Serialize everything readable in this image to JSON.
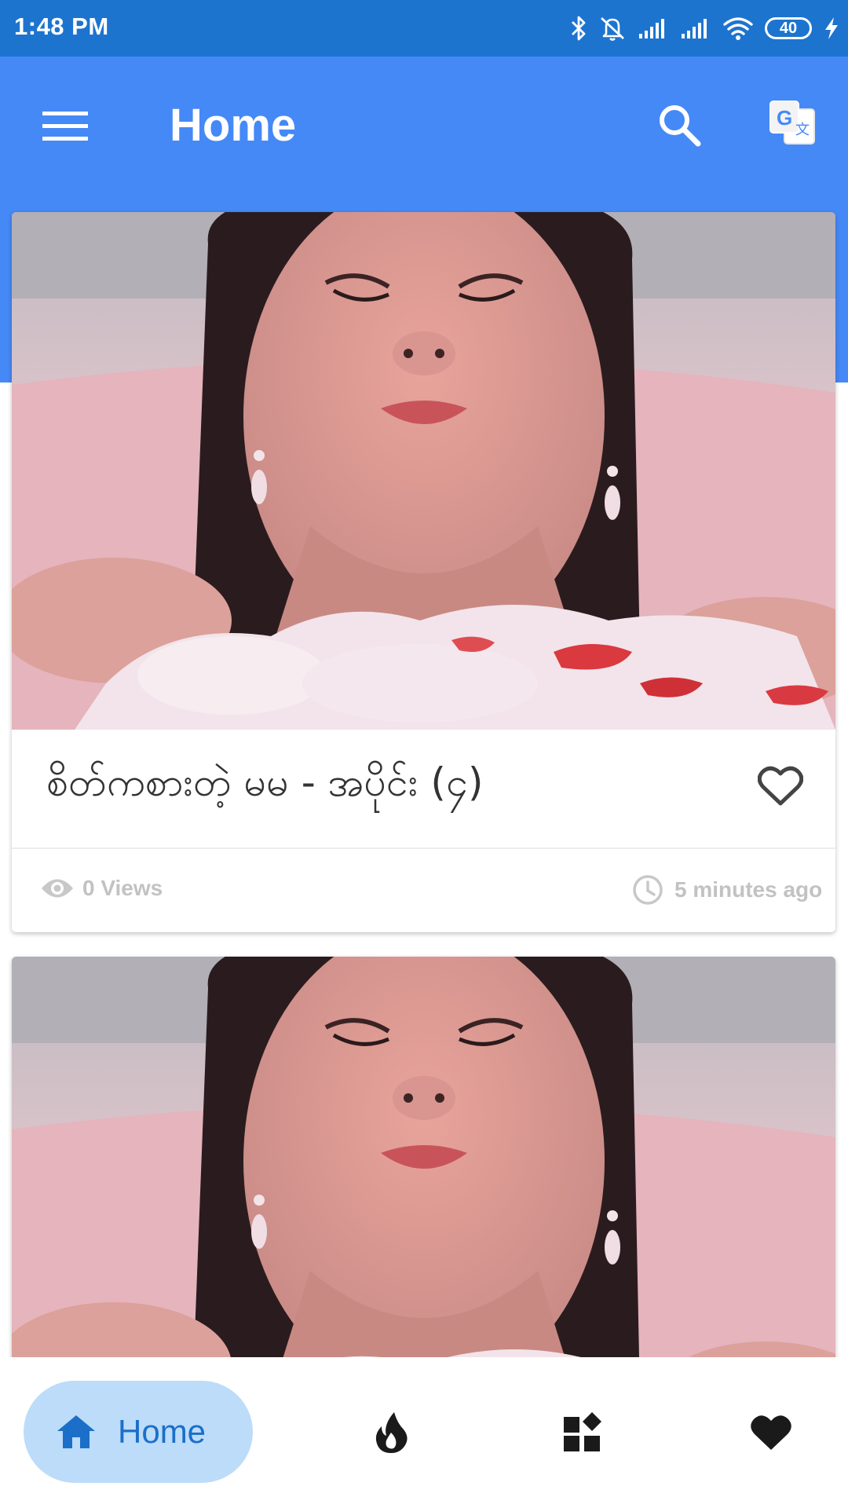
{
  "status_bar": {
    "time": "1:48 PM",
    "battery_level": "40",
    "icons": [
      "bluetooth-icon",
      "mute-icon",
      "signal-icon",
      "signal-icon",
      "wifi-icon",
      "battery-icon",
      "charging-icon"
    ]
  },
  "app_bar": {
    "title": "Home",
    "color": "#4589f6",
    "icons": [
      "menu-icon",
      "search-icon",
      "translate-icon"
    ]
  },
  "feed": {
    "cards": [
      {
        "title": "စိတ်ကစားတဲ့ မမ - အပိုင်း (၄)",
        "views": "0 Views",
        "time_ago": "5 minutes ago"
      },
      {
        "title": "",
        "views": "",
        "time_ago": ""
      }
    ]
  },
  "bottom_nav": {
    "active_color": "#1b6fc9",
    "active_bg": "#bcdcf9",
    "items": [
      {
        "label": "Home",
        "icon": "home-icon",
        "active": true
      },
      {
        "label": "",
        "icon": "trending-icon",
        "active": false
      },
      {
        "label": "",
        "icon": "categories-icon",
        "active": false
      },
      {
        "label": "",
        "icon": "favorite-icon",
        "active": false
      }
    ]
  }
}
